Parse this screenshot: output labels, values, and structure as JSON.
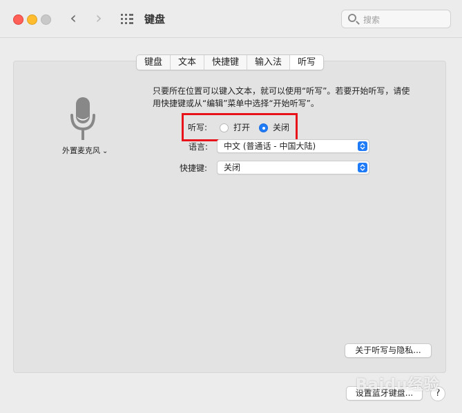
{
  "window": {
    "title": "键盘"
  },
  "toolbar": {
    "back_icon": "chevron-left-icon",
    "forward_icon": "chevron-right-icon",
    "grid_icon": "show-all-grid-icon",
    "search_placeholder": "搜索"
  },
  "tabs": [
    {
      "label": "键盘",
      "active": false
    },
    {
      "label": "文本",
      "active": false
    },
    {
      "label": "快捷键",
      "active": false
    },
    {
      "label": "输入法",
      "active": false
    },
    {
      "label": "听写",
      "active": true
    }
  ],
  "microphone": {
    "label": "外置麦克风",
    "icon": "microphone-icon"
  },
  "description": "只要所在位置可以键入文本，就可以使用“听写”。若要开始听写，请使用快捷键或从“编辑”菜单中选择“开始听写”。",
  "dictation": {
    "label": "听写:",
    "options": [
      {
        "label": "打开",
        "selected": false
      },
      {
        "label": "关闭",
        "selected": true
      }
    ]
  },
  "language": {
    "label": "语言:",
    "value": "中文 (普通话 - 中国大陆)"
  },
  "shortcut": {
    "label": "快捷键:",
    "value": "关闭"
  },
  "buttons": {
    "privacy": "关于听写与隐私...",
    "bluetooth": "设置蓝牙键盘...",
    "help": "?"
  },
  "watermark": "Baidu经验",
  "colors": {
    "accent": "#1f7bf6",
    "highlight": "#e8131a"
  }
}
